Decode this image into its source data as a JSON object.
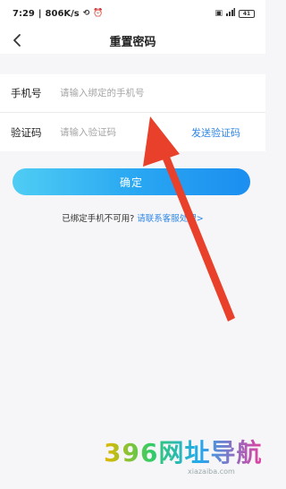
{
  "status_bar": {
    "time": "7:29",
    "speed": "806K/s",
    "battery": "41"
  },
  "nav": {
    "title": "重置密码"
  },
  "form": {
    "phone_label": "手机号",
    "phone_placeholder": "请输入绑定的手机号",
    "code_label": "验证码",
    "code_placeholder": "请输入验证码",
    "send_code": "发送验证码"
  },
  "confirm_label": "确定",
  "help": {
    "prefix": "已绑定手机不可用?",
    "link": "请联系客服处理>"
  },
  "watermark": {
    "text": "396网址导航",
    "sub": "xiazaiba.com"
  },
  "colors": {
    "accent": "#2e86e8",
    "button_start": "#4fcdf4",
    "button_end": "#1b8ef0",
    "arrow": "#e8402a"
  }
}
